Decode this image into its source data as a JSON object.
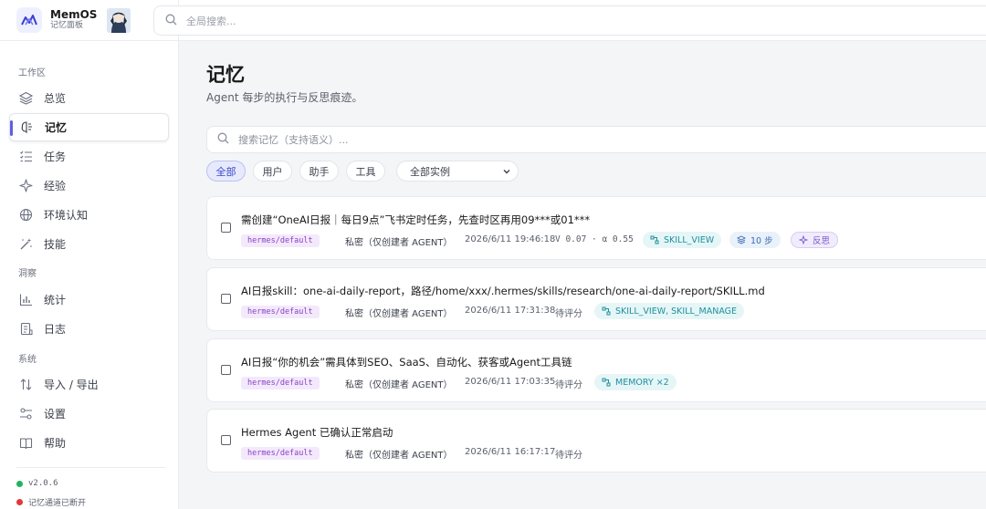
{
  "brand": {
    "name": "MemOS",
    "subtitle": "记忆面板"
  },
  "global_search": {
    "placeholder": "全局搜索..."
  },
  "sidebar": {
    "sections": [
      {
        "label": "工作区"
      },
      {
        "label": "洞察"
      },
      {
        "label": "系统"
      }
    ],
    "items": [
      {
        "label": "总览",
        "icon": "layers-icon"
      },
      {
        "label": "记忆",
        "icon": "brain-icon",
        "active": true
      },
      {
        "label": "任务",
        "icon": "task-list-icon"
      },
      {
        "label": "经验",
        "icon": "sparkle-icon"
      },
      {
        "label": "环境认知",
        "icon": "globe-icon"
      },
      {
        "label": "技能",
        "icon": "magic-wand-icon"
      },
      {
        "label": "统计",
        "icon": "bar-chart-icon"
      },
      {
        "label": "日志",
        "icon": "log-icon"
      },
      {
        "label": "导入 / 导出",
        "icon": "import-export-icon"
      },
      {
        "label": "设置",
        "icon": "settings-icon"
      },
      {
        "label": "帮助",
        "icon": "book-icon"
      }
    ],
    "version": "v2.0.6",
    "version_color": "#22b35e",
    "connection_status": "记忆通道已断开",
    "connection_color": "#e03a3a"
  },
  "page": {
    "title": "记忆",
    "subtitle": "Agent 每步的执行与反思痕迹。"
  },
  "memory_search": {
    "placeholder": "搜索记忆（支持语义）..."
  },
  "filters": {
    "chips": [
      {
        "label": "全部",
        "active": true
      },
      {
        "label": "用户"
      },
      {
        "label": "助手"
      },
      {
        "label": "工具"
      }
    ],
    "instance_select": "全部实例"
  },
  "memories": [
    {
      "title": "需创建“OneAI日报｜每日9点”飞书定时任务，先查时区再用09***或01***",
      "namespace": "hermes/default",
      "privacy": "私密（仅创建者 AGENT）",
      "time": "2026/6/11 19:46:18",
      "score": "V 0.07 · α 0.55",
      "tools": "SKILL_VIEW",
      "steps": "10 步",
      "reflect": "反思"
    },
    {
      "title": "AI日报skill：one-ai-daily-report，路径/home/xxx/.hermes/skills/research/one-ai-daily-report/SKILL.md",
      "namespace": "hermes/default",
      "privacy": "私密（仅创建者 AGENT）",
      "time": "2026/6/11 17:31:38",
      "score": "待评分",
      "tools": "SKILL_VIEW, SKILL_MANAGE"
    },
    {
      "title": "AI日报“你的机会”需具体到SEO、SaaS、自动化、获客或Agent工具链",
      "namespace": "hermes/default",
      "privacy": "私密（仅创建者 AGENT）",
      "time": "2026/6/11 17:03:35",
      "score": "待评分",
      "tools": "MEMORY ×2"
    },
    {
      "title": "Hermes Agent 已确认正常启动",
      "namespace": "hermes/default",
      "privacy": "私密（仅创建者 AGENT）",
      "time": "2026/6/11 16:17:17",
      "score": "待评分"
    }
  ]
}
